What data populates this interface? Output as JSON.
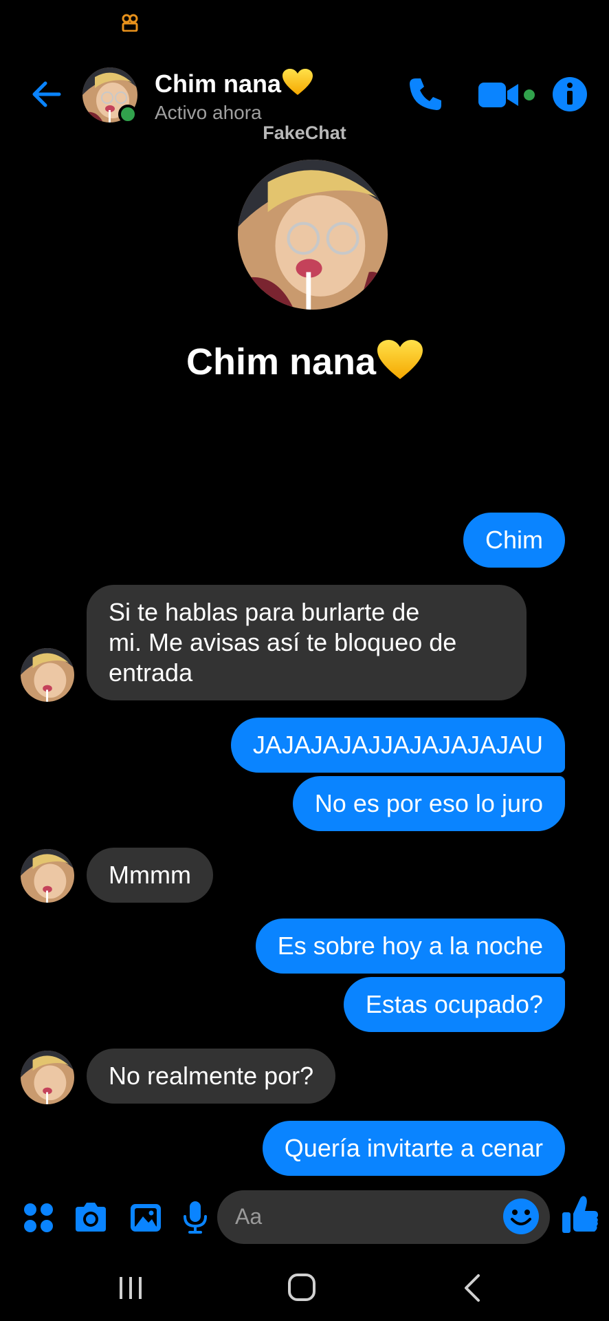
{
  "header": {
    "contact_name": "Chim nana",
    "status": "Activo ahora"
  },
  "watermark": "FakeChat",
  "profile": {
    "name": "Chim nana"
  },
  "messages": [
    {
      "from": "me",
      "text": "Chim"
    },
    {
      "from": "them",
      "lines": [
        "Si te hablas para burlarte de",
        "mi. Me avisas así te bloqueo de",
        "entrada"
      ]
    },
    {
      "from": "me",
      "text": "JAJAJAJAJJAJAJAJAJAU"
    },
    {
      "from": "me",
      "text": "No es por eso lo juro"
    },
    {
      "from": "them",
      "text": "Mmmm"
    },
    {
      "from": "me",
      "text": "Es sobre hoy a la noche"
    },
    {
      "from": "me",
      "text": "Estas ocupado?"
    },
    {
      "from": "them",
      "text": "No realmente por?"
    },
    {
      "from": "me",
      "text": "Quería invitarte a cenar"
    }
  ],
  "composer": {
    "placeholder": "Aa"
  },
  "icons": {
    "back": "arrow-left-icon",
    "call": "phone-icon",
    "video": "video-camera-icon",
    "info": "info-icon",
    "apps": "four-dots-icon",
    "camera": "camera-icon",
    "gallery": "image-icon",
    "mic": "microphone-icon",
    "emoji": "smiley-icon",
    "like": "thumbs-up-icon"
  },
  "colors": {
    "accent": "#0a84ff",
    "incoming_bubble": "#333333",
    "online": "#31a24c",
    "background": "#000000"
  }
}
